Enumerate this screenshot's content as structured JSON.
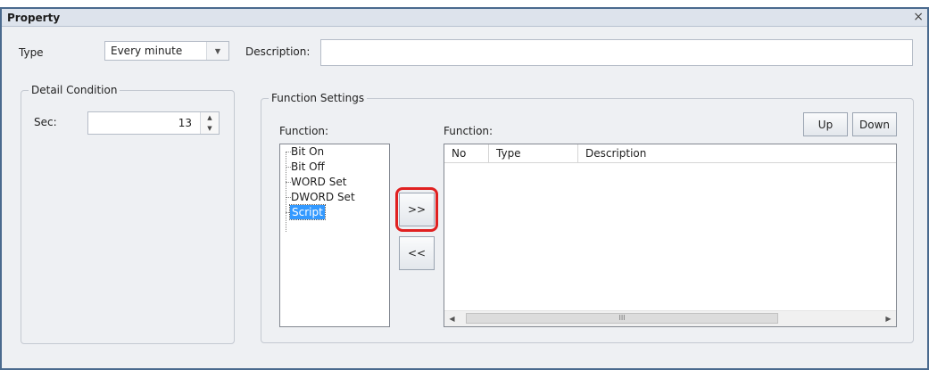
{
  "window": {
    "title": "Property",
    "close_glyph": "×"
  },
  "type": {
    "label": "Type",
    "value": "Every minute"
  },
  "description": {
    "label": "Description:",
    "value": ""
  },
  "detail_condition": {
    "legend": "Detail Condition",
    "sec_label": "Sec:",
    "sec_value": "13"
  },
  "function_settings": {
    "legend": "Function Settings",
    "available_label": "Function:",
    "selected_label": "Function:",
    "available_items": [
      "Bit On",
      "Bit Off",
      "WORD Set",
      "DWORD Set",
      "Script"
    ],
    "selected_item": "Script",
    "add_button": ">>",
    "remove_button": "<<",
    "up_button": "Up",
    "down_button": "Down",
    "columns": [
      "No",
      "Type",
      "Description"
    ],
    "rows": [],
    "scroll_thumb_glyph": "III"
  },
  "icons": {
    "dropdown": "chevron-down-icon",
    "spin_up": "spin-up-icon",
    "spin_down": "spin-down-icon",
    "close": "close-icon"
  }
}
